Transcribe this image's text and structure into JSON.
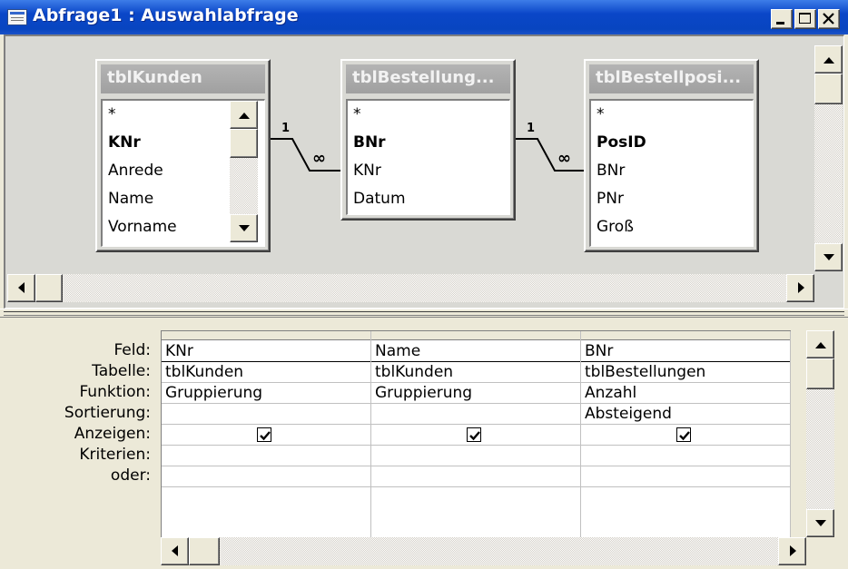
{
  "window": {
    "title": "Abfrage1 : Auswahlabfrage",
    "controls": [
      "minimize",
      "maximize",
      "close"
    ]
  },
  "tables": [
    {
      "title": "tblKunden",
      "fields": [
        "*",
        "KNr",
        "Anrede",
        "Name",
        "Vorname"
      ],
      "primary_key": "KNr"
    },
    {
      "title": "tblBestellung...",
      "fields": [
        "*",
        "BNr",
        "KNr",
        "Datum"
      ],
      "primary_key": "BNr"
    },
    {
      "title": "tblBestellposi...",
      "fields": [
        "*",
        "PosID",
        "BNr",
        "PNr",
        "Groß"
      ],
      "primary_key": "PosID"
    }
  ],
  "relationships": [
    {
      "one_label": "1",
      "many_label": "∞"
    },
    {
      "one_label": "1",
      "many_label": "∞"
    }
  ],
  "qbe": {
    "row_labels": [
      "Feld:",
      "Tabelle:",
      "Funktion:",
      "Sortierung:",
      "Anzeigen:",
      "Kriterien:",
      "oder:"
    ],
    "columns": [
      {
        "feld": "KNr",
        "tabelle": "tblKunden",
        "funktion": "Gruppierung",
        "sortierung": "",
        "anzeigen": true
      },
      {
        "feld": "Name",
        "tabelle": "tblKunden",
        "funktion": "Gruppierung",
        "sortierung": "",
        "anzeigen": true
      },
      {
        "feld": "BNr",
        "tabelle": "tblBestellungen",
        "funktion": "Anzahl",
        "sortierung": "Absteigend",
        "anzeigen": true
      }
    ]
  },
  "icons": [
    "query-window-icon",
    "minimize-icon",
    "maximize-icon",
    "close-icon",
    "scroll-up-arrow-icon",
    "scroll-down-arrow-icon",
    "scroll-left-arrow-icon",
    "scroll-right-arrow-icon",
    "checkbox-checked-icon"
  ]
}
